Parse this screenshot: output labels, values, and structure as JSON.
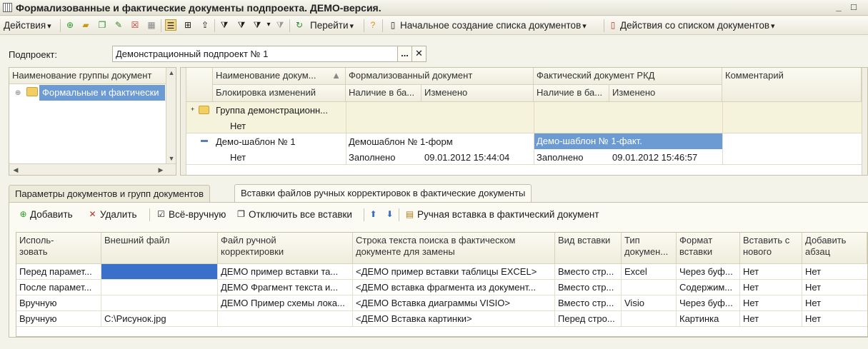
{
  "window": {
    "title": "Формализованные и фактические документы подпроекта. ДЕМО-версия.",
    "min_label": "_",
    "max_label": "□",
    "close_label": "✕"
  },
  "toolbar": {
    "actions": "Действия",
    "goto": "Перейти",
    "initial_create": "Начальное создание списка документов",
    "list_actions": "Действия со списком документов"
  },
  "subproject": {
    "label": "Подпроект:",
    "value": "Демонстрационный подпроект № 1",
    "select_label": "...",
    "clear_label": "✕"
  },
  "tree": {
    "header": "Наименование группы документ",
    "items": [
      {
        "label": "Формальные и фактически"
      }
    ]
  },
  "grid": {
    "headers": {
      "name": "Наименование докум...",
      "formal": "Формализованный документ",
      "actual": "Фактический документ РКД",
      "comment": "Комментарий",
      "lock": "Блокировка изменений",
      "f_presence": "Наличие в ба...",
      "f_changed": "Изменено",
      "a_presence": "Наличие в ба...",
      "a_changed": "Изменено"
    },
    "rows": [
      {
        "name": "Группа демонстрационн...",
        "lock": "Нет",
        "formal": "",
        "f_presence": "",
        "f_changed": "",
        "actual": "",
        "a_presence": "",
        "a_changed": "",
        "comment": ""
      },
      {
        "name": "Демо-шаблон № 1",
        "lock": "Нет",
        "formal": "Демошаблон № 1-форм",
        "f_presence": "Заполнено",
        "f_changed": "09.01.2012 15:44:04",
        "actual": "Демо-шаблон № 1-факт.",
        "a_presence": "Заполнено",
        "a_changed": "09.01.2012 15:46:57",
        "comment": ""
      }
    ]
  },
  "tabs": [
    {
      "label": "Параметры документов и групп документов"
    },
    {
      "label": "Вставки файлов ручных корректировок в фактические документы"
    }
  ],
  "bottom_toolbar": {
    "add": "Добавить",
    "delete": "Удалить",
    "all_manual": "Всё-вручную",
    "disable_all": "Отключить все вставки",
    "manual_insert": "Ручная вставка в фактический документ"
  },
  "inserts": {
    "headers": {
      "use": "Исполь-\nзовать",
      "external": "Внешний файл",
      "manual_file": "Файл ручной\nкорректировки",
      "search": "Строка текста поиска в фактическом\nдокументе для замены",
      "kind": "Вид вставки",
      "type": "Тип\nдокумен...",
      "format": "Формат\nвставки",
      "newline": "Вставить с\nнового",
      "paragraph": "Добавить\nабзац"
    },
    "rows": [
      {
        "use": "Перед парамет...",
        "external": "",
        "manual_file": "ДЕМО пример вставки та...",
        "search": "<ДЕМО пример вставки таблицы EXCEL>",
        "kind": "Вместо стр...",
        "type": "Excel",
        "format": "Через буф...",
        "newline": "Нет",
        "paragraph": "Нет"
      },
      {
        "use": "После парамет...",
        "external": "",
        "manual_file": "ДЕМО Фрагмент текста и...",
        "search": "<ДЕМО вставка фрагмента из документ...",
        "kind": "Вместо стр...",
        "type": "",
        "format": "Содержим...",
        "newline": "Нет",
        "paragraph": "Нет"
      },
      {
        "use": "Вручную",
        "external": "",
        "manual_file": "ДЕМО Пример схемы лока...",
        "search": "<ДЕМО Вставка диаграммы VISIO>",
        "kind": "Вместо стр...",
        "type": "Visio",
        "format": "Через буф...",
        "newline": "Нет",
        "paragraph": "Нет"
      },
      {
        "use": "Вручную",
        "external": "C:\\Рисунок.jpg",
        "manual_file": "",
        "search": "<ДЕМО Вставка картинки>",
        "kind": "Перед стро...",
        "type": "",
        "format": "Картинка",
        "newline": "Нет",
        "paragraph": "Нет"
      }
    ]
  }
}
